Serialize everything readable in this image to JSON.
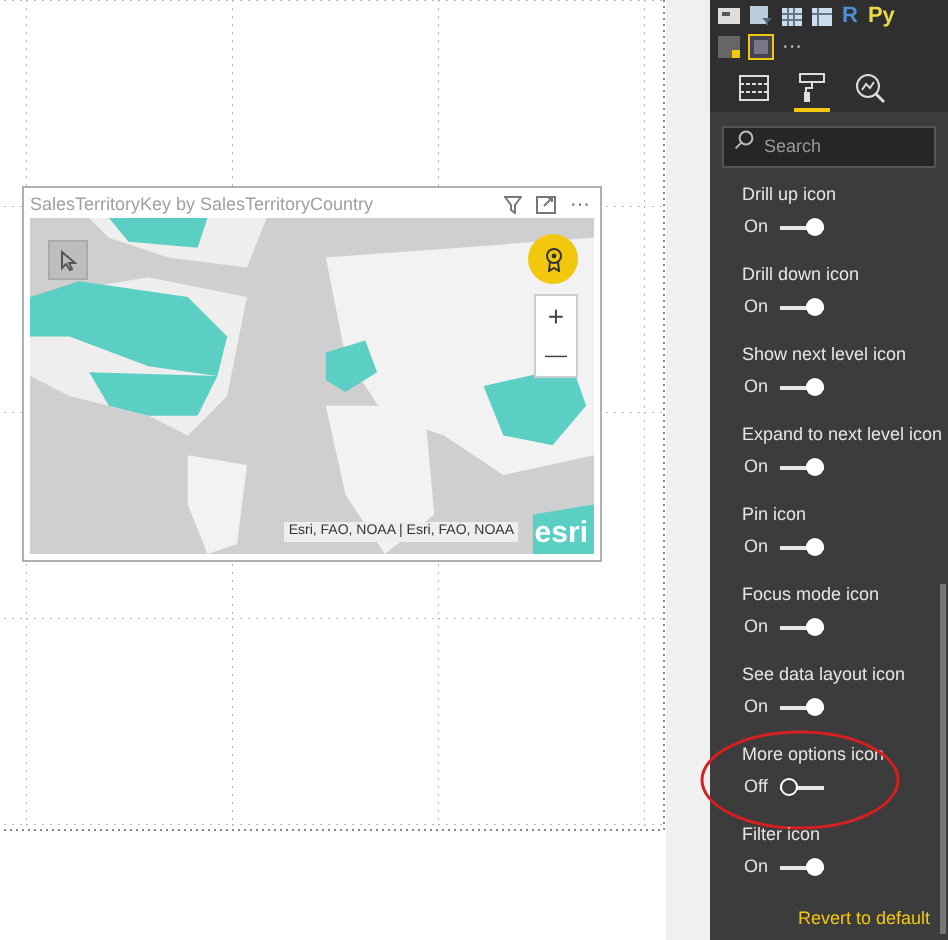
{
  "visual": {
    "title": "SalesTerritoryKey by SalesTerritoryCountry",
    "attribution": "Esri, FAO, NOAA | Esri, FAO, NOAA",
    "logo": "esri",
    "zoom_in": "+",
    "zoom_out": "—",
    "more": "···"
  },
  "visualizations": {
    "script_visuals": [
      {
        "label": "R",
        "color": "#4f8fd6"
      },
      {
        "label": "Py",
        "color": "#e8d84a"
      }
    ],
    "more": "···"
  },
  "pane_tabs": [
    {
      "kind": "fields",
      "selected": false
    },
    {
      "kind": "format",
      "selected": true
    },
    {
      "kind": "analytics",
      "selected": false
    }
  ],
  "search": {
    "placeholder": "Search"
  },
  "settings": [
    {
      "label": "Drill up icon",
      "state": "On",
      "on": true
    },
    {
      "label": "Drill down icon",
      "state": "On",
      "on": true
    },
    {
      "label": "Show next level icon",
      "state": "On",
      "on": true
    },
    {
      "label": "Expand to next level icon",
      "state": "On",
      "on": true
    },
    {
      "label": "Pin icon",
      "state": "On",
      "on": true
    },
    {
      "label": "Focus mode icon",
      "state": "On",
      "on": true
    },
    {
      "label": "See data layout icon",
      "state": "On",
      "on": true
    },
    {
      "label": "More options icon",
      "state": "Off",
      "on": false,
      "circled": true
    },
    {
      "label": "Filter icon",
      "state": "On",
      "on": true
    }
  ],
  "revert": "Revert to default"
}
